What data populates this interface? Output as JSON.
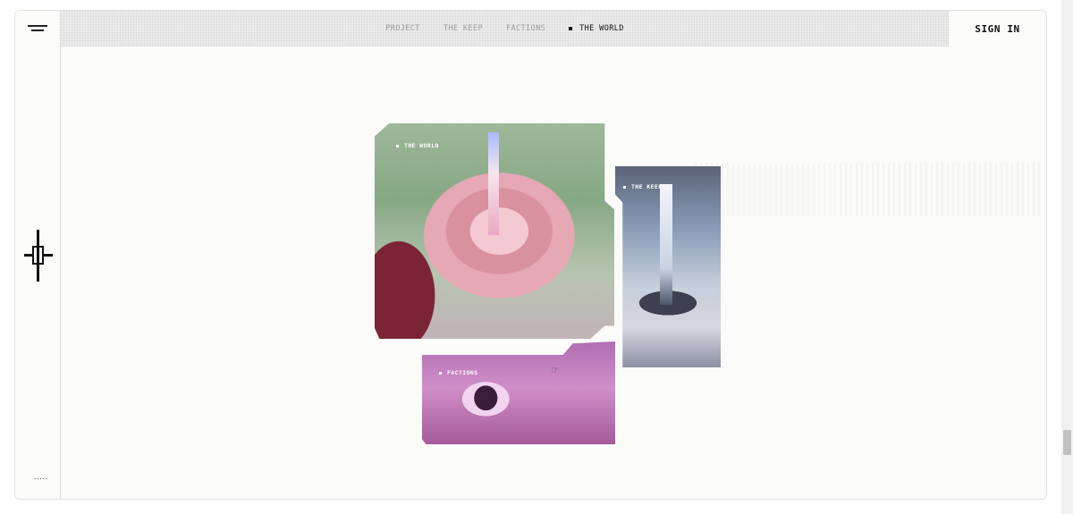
{
  "nav": {
    "items": [
      {
        "label": "PROJECT",
        "active": false
      },
      {
        "label": "THE KEEP",
        "active": false
      },
      {
        "label": "FACTIONS",
        "active": false
      },
      {
        "label": "THE WORLD",
        "active": true
      }
    ],
    "menu_icon": "hamburger-icon"
  },
  "header": {
    "sign_in_label": "SIGN IN"
  },
  "sidebar": {
    "crosshair_icon": "crosshair-icon",
    "dots_text": "....."
  },
  "panels": {
    "world_label": "THE WORLD",
    "keep_label": "THE KEEP",
    "factions_label": "FACTIONS"
  },
  "colors": {
    "background": "#fbfbfa",
    "nav_strip": "#ececec",
    "text_active": "#111111",
    "text_inactive": "#9a9a9a"
  }
}
